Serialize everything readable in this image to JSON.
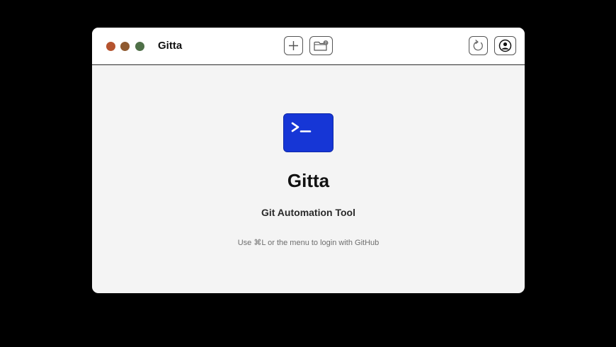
{
  "window": {
    "title": "Gitta",
    "traffic_lights": {
      "close_color": "#b5532e",
      "minimize_color": "#8f5a30",
      "zoom_color": "#4f7048"
    },
    "toolbar": {
      "buttons": [
        {
          "icon": "plus-icon",
          "label": "New"
        },
        {
          "icon": "folder-badge-icon",
          "label": "Open folder"
        },
        {
          "icon": "refresh-icon",
          "label": "Refresh"
        },
        {
          "icon": "account-icon",
          "label": "Account"
        }
      ]
    }
  },
  "welcome": {
    "icon": "terminal-icon",
    "icon_prompt": ">_",
    "icon_color": "#1636d6",
    "app_name": "Gitta",
    "tagline": "Git Automation Tool",
    "hint": "Use ⌘L or the menu to login with GitHub"
  }
}
